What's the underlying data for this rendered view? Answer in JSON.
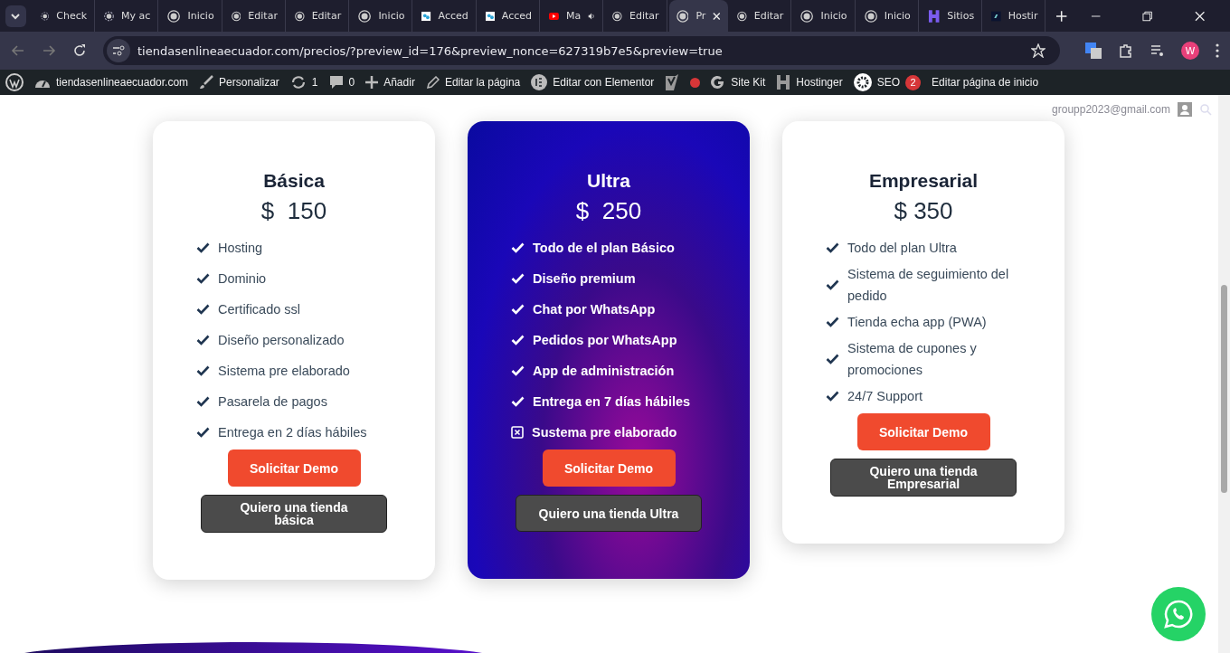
{
  "browser": {
    "tabs": [
      {
        "title": "Check",
        "kind": "dashed",
        "selected": false,
        "audio": false
      },
      {
        "title": "My ac",
        "kind": "dashed",
        "selected": false,
        "audio": false
      },
      {
        "title": "Inicio",
        "kind": "globe",
        "selected": false,
        "audio": false
      },
      {
        "title": "Editar",
        "kind": "globe",
        "selected": false,
        "audio": false
      },
      {
        "title": "Editar",
        "kind": "globe",
        "selected": false,
        "audio": false
      },
      {
        "title": "Inicio",
        "kind": "globe",
        "selected": false,
        "audio": false
      },
      {
        "title": "Acced",
        "kind": "app",
        "selected": false,
        "audio": false
      },
      {
        "title": "Acced",
        "kind": "app",
        "selected": false,
        "audio": false
      },
      {
        "title": "Ma",
        "kind": "video",
        "selected": false,
        "audio": true
      },
      {
        "title": "Editar",
        "kind": "globe",
        "selected": false,
        "audio": false
      },
      {
        "title": "Pr",
        "kind": "globe",
        "selected": true,
        "audio": false
      },
      {
        "title": "Editar",
        "kind": "globe",
        "selected": false,
        "audio": false
      },
      {
        "title": "Inicio",
        "kind": "globe",
        "selected": false,
        "audio": false
      },
      {
        "title": "Inicio",
        "kind": "globe",
        "selected": false,
        "audio": false
      },
      {
        "title": "Sitios",
        "kind": "h",
        "selected": false,
        "audio": false
      },
      {
        "title": "Hostir",
        "kind": "dark",
        "selected": false,
        "audio": false
      }
    ],
    "url": "tiendasenlineaecuador.com/precios/?preview_id=176&preview_nonce=627319b7e5&preview=true",
    "profile": "W"
  },
  "admin_bar": [
    {
      "kind": "wp"
    },
    {
      "kind": "site",
      "label": "tiendasenlineaecuador.com"
    },
    {
      "kind": "brush",
      "label": "Personalizar"
    },
    {
      "kind": "sync",
      "label": "1"
    },
    {
      "kind": "comment",
      "label": "0"
    },
    {
      "kind": "plus",
      "label": "Añadir"
    },
    {
      "kind": "pencil",
      "label": "Editar la página"
    },
    {
      "kind": "elementor",
      "label": "Editar con Elementor"
    },
    {
      "kind": "yoast"
    },
    {
      "kind": "dot"
    },
    {
      "kind": "g",
      "label": "Site Kit"
    },
    {
      "kind": "h",
      "label": "Hostinger"
    },
    {
      "kind": "seo",
      "label": "SEO",
      "badge": "2"
    },
    {
      "kind": "text",
      "label": "Editar página de inicio"
    }
  ],
  "user_email": "groupp2023@gmail.com",
  "plans": [
    {
      "kind": "light",
      "name": "Básica",
      "price": "$  150",
      "features": [
        {
          "kind": "check",
          "text": "Hosting"
        },
        {
          "kind": "check",
          "text": "Dominio"
        },
        {
          "kind": "check",
          "text": "Certificado ssl"
        },
        {
          "kind": "check",
          "text": "Diseño personalizado"
        },
        {
          "kind": "check",
          "text": "Sistema pre elaborado"
        },
        {
          "kind": "check",
          "text": "Pasarela de pagos"
        },
        {
          "kind": "check",
          "text": "Entrega en 2 días hábiles"
        }
      ],
      "demo_button": "Solicitar Demo",
      "buy_button": "Quiero una tienda básica"
    },
    {
      "kind": "gradient",
      "name": "Ultra",
      "price": "$  250",
      "features": [
        {
          "kind": "check",
          "text": "Todo de el plan Básico"
        },
        {
          "kind": "check",
          "text": "Diseño premium"
        },
        {
          "kind": "check",
          "text": "Chat por WhatsApp"
        },
        {
          "kind": "check",
          "text": "Pedidos por WhatsApp"
        },
        {
          "kind": "check",
          "text": "App de administración"
        },
        {
          "kind": "check",
          "text": "Entrega en 7 días hábiles"
        },
        {
          "kind": "cross",
          "text": "Sustema pre elaborado"
        }
      ],
      "demo_button": "Solicitar Demo",
      "buy_button": "Quiero una tienda Ultra"
    },
    {
      "kind": "light",
      "name": "Empresarial",
      "price": "$ 350",
      "features": [
        {
          "kind": "check",
          "text": "Todo del plan Ultra"
        },
        {
          "kind": "check",
          "text": "Sistema de seguimiento del pedido"
        },
        {
          "kind": "check",
          "text": "Tienda echa app (PWA)"
        },
        {
          "kind": "check",
          "text": "Sistema de cupones y promociones"
        },
        {
          "kind": "check",
          "text": "24/7 Support"
        }
      ],
      "demo_button": "Solicitar Demo",
      "buy_button": "Quiero una tienda Empresarial"
    }
  ]
}
